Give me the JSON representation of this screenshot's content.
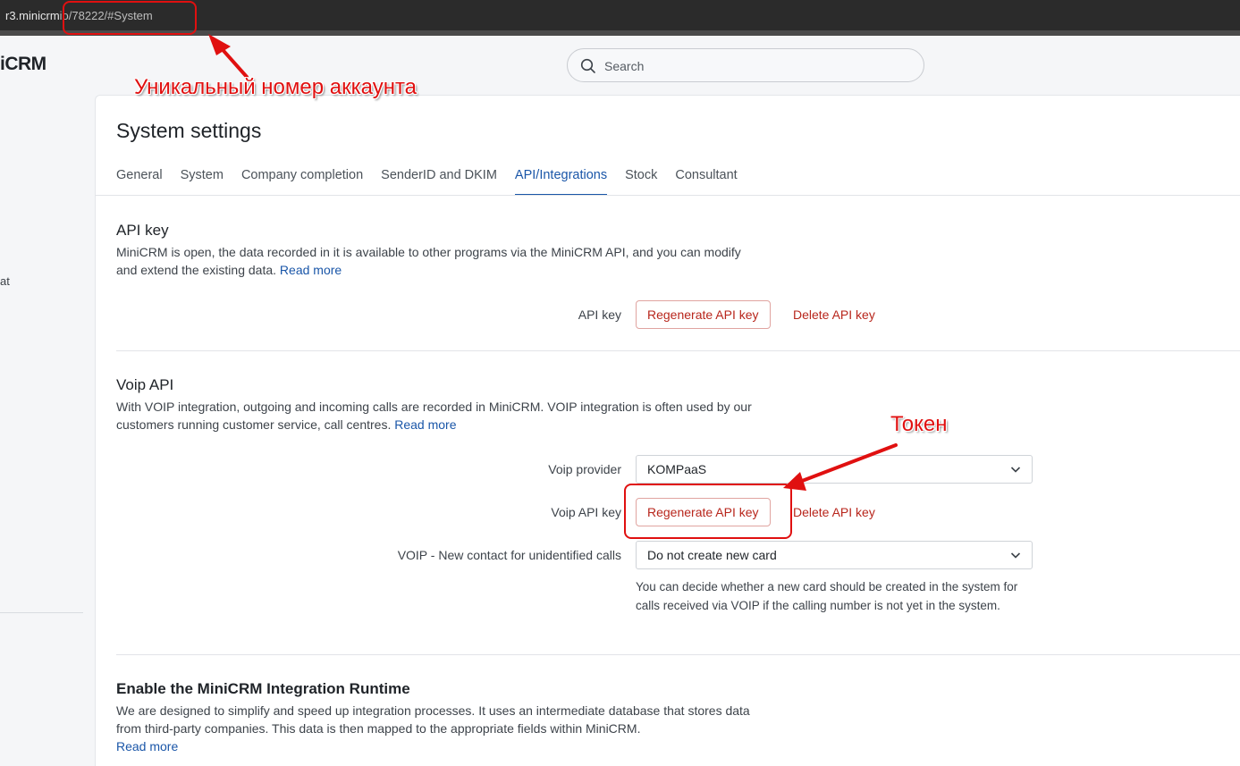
{
  "browser": {
    "url_host": "r3.minicrm",
    "url_rest": "io/78222/#System"
  },
  "sidebar": {
    "brand": "iCRM",
    "fragment": "at"
  },
  "search": {
    "placeholder": "Search"
  },
  "page": {
    "title": "System settings",
    "tabs": [
      {
        "label": "General",
        "active": false
      },
      {
        "label": "System",
        "active": false
      },
      {
        "label": "Company completion",
        "active": false
      },
      {
        "label": "SenderID and DKIM",
        "active": false
      },
      {
        "label": "API/Integrations",
        "active": true
      },
      {
        "label": "Stock",
        "active": false
      },
      {
        "label": "Consultant",
        "active": false
      }
    ]
  },
  "api_key": {
    "title": "API key",
    "desc": "MiniCRM is open, the data recorded in it is available to other programs via the MiniCRM API, and you can modify and extend the existing data.",
    "read_more": "Read more",
    "row_label": "API key",
    "regenerate": "Regenerate API key",
    "delete": "Delete API key"
  },
  "voip": {
    "title": "Voip API",
    "desc": "With VOIP integration, outgoing and incoming calls are recorded in MiniCRM. VOIP integration is often used by our customers running customer service, call centres.",
    "read_more": "Read more",
    "provider_label": "Voip provider",
    "provider_value": "KOMPaaS",
    "key_label": "Voip API key",
    "regenerate": "Regenerate API key",
    "delete": "Delete API key",
    "new_contact_label": "VOIP - New contact for unidentified calls",
    "new_contact_value": "Do not create new card",
    "new_contact_help": "You can decide whether a new card should be created in the system for calls received via VOIP if the calling number is not yet in the system."
  },
  "runtime": {
    "title": "Enable the MiniCRM Integration Runtime",
    "desc": "We are designed to simplify and speed up integration processes. It uses an intermediate database that stores data from third-party companies. This data is then mapped to the appropriate fields within MiniCRM.",
    "read_more": "Read more"
  },
  "annotations": {
    "account_label": "Уникальный номер аккаунта",
    "token_label": "Токен",
    "color": "#e01010"
  }
}
